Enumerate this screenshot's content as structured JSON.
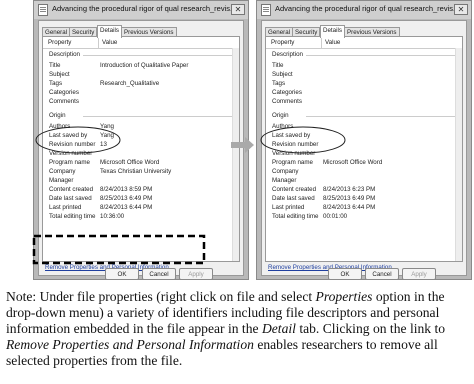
{
  "window_title": "Advancing the procedural rigor of qual research_revis...",
  "close_glyph": "✕",
  "tabs": [
    "General",
    "Security",
    "Details",
    "Previous Versions"
  ],
  "columns": {
    "property": "Property",
    "value": "Value"
  },
  "sections": {
    "description": "Description",
    "origin": "Origin"
  },
  "left_description": [
    {
      "k": "Title",
      "v": "Introduction of Qualitative Paper"
    },
    {
      "k": "Subject",
      "v": ""
    },
    {
      "k": "Tags",
      "v": "Research_Qualitative"
    },
    {
      "k": "Categories",
      "v": ""
    },
    {
      "k": "Comments",
      "v": ""
    }
  ],
  "left_origin": [
    {
      "k": "Authors",
      "v": "Yang"
    },
    {
      "k": "Last saved by",
      "v": "Yang"
    },
    {
      "k": "Revision number",
      "v": "13"
    },
    {
      "k": "Version number",
      "v": ""
    },
    {
      "k": "Program name",
      "v": "Microsoft Office Word"
    },
    {
      "k": "Company",
      "v": "Texas Christian University"
    },
    {
      "k": "Manager",
      "v": ""
    },
    {
      "k": "Content created",
      "v": "8/24/2013 8:59 PM"
    },
    {
      "k": "Date last saved",
      "v": "8/25/2013 6:49 PM"
    },
    {
      "k": "Last printed",
      "v": "8/24/2013 6:44 PM"
    },
    {
      "k": "Total editing time",
      "v": "10:36:00"
    }
  ],
  "right_description": [
    {
      "k": "Title",
      "v": ""
    },
    {
      "k": "Subject",
      "v": ""
    },
    {
      "k": "Tags",
      "v": ""
    },
    {
      "k": "Categories",
      "v": ""
    },
    {
      "k": "Comments",
      "v": ""
    }
  ],
  "right_origin": [
    {
      "k": "Authors",
      "v": ""
    },
    {
      "k": "Last saved by",
      "v": ""
    },
    {
      "k": "Revision number",
      "v": ""
    },
    {
      "k": "Version number",
      "v": ""
    },
    {
      "k": "Program name",
      "v": "Microsoft Office Word"
    },
    {
      "k": "Company",
      "v": ""
    },
    {
      "k": "Manager",
      "v": ""
    },
    {
      "k": "Content created",
      "v": "8/24/2013 6:23 PM"
    },
    {
      "k": "Date last saved",
      "v": "8/25/2013 6:49 PM"
    },
    {
      "k": "Last printed",
      "v": "8/24/2013 6:44 PM"
    },
    {
      "k": "Total editing time",
      "v": "00:01:00"
    }
  ],
  "link_text": "Remove Properties and Personal Information",
  "buttons": {
    "ok": "OK",
    "cancel": "Cancel",
    "apply": "Apply"
  },
  "note": {
    "p1": "Note: Under file properties (right click on file and select ",
    "p2": "Properties",
    "p3": " option in the drop-down menu) a variety of identifiers including file descriptors and personal information embedded in the file appear in the ",
    "p4": "Detail",
    "p5": " tab. Clicking on the link to ",
    "p6": "Remove Properties and Personal Information",
    "p7": " enables researchers to remove all selected properties from the file."
  }
}
